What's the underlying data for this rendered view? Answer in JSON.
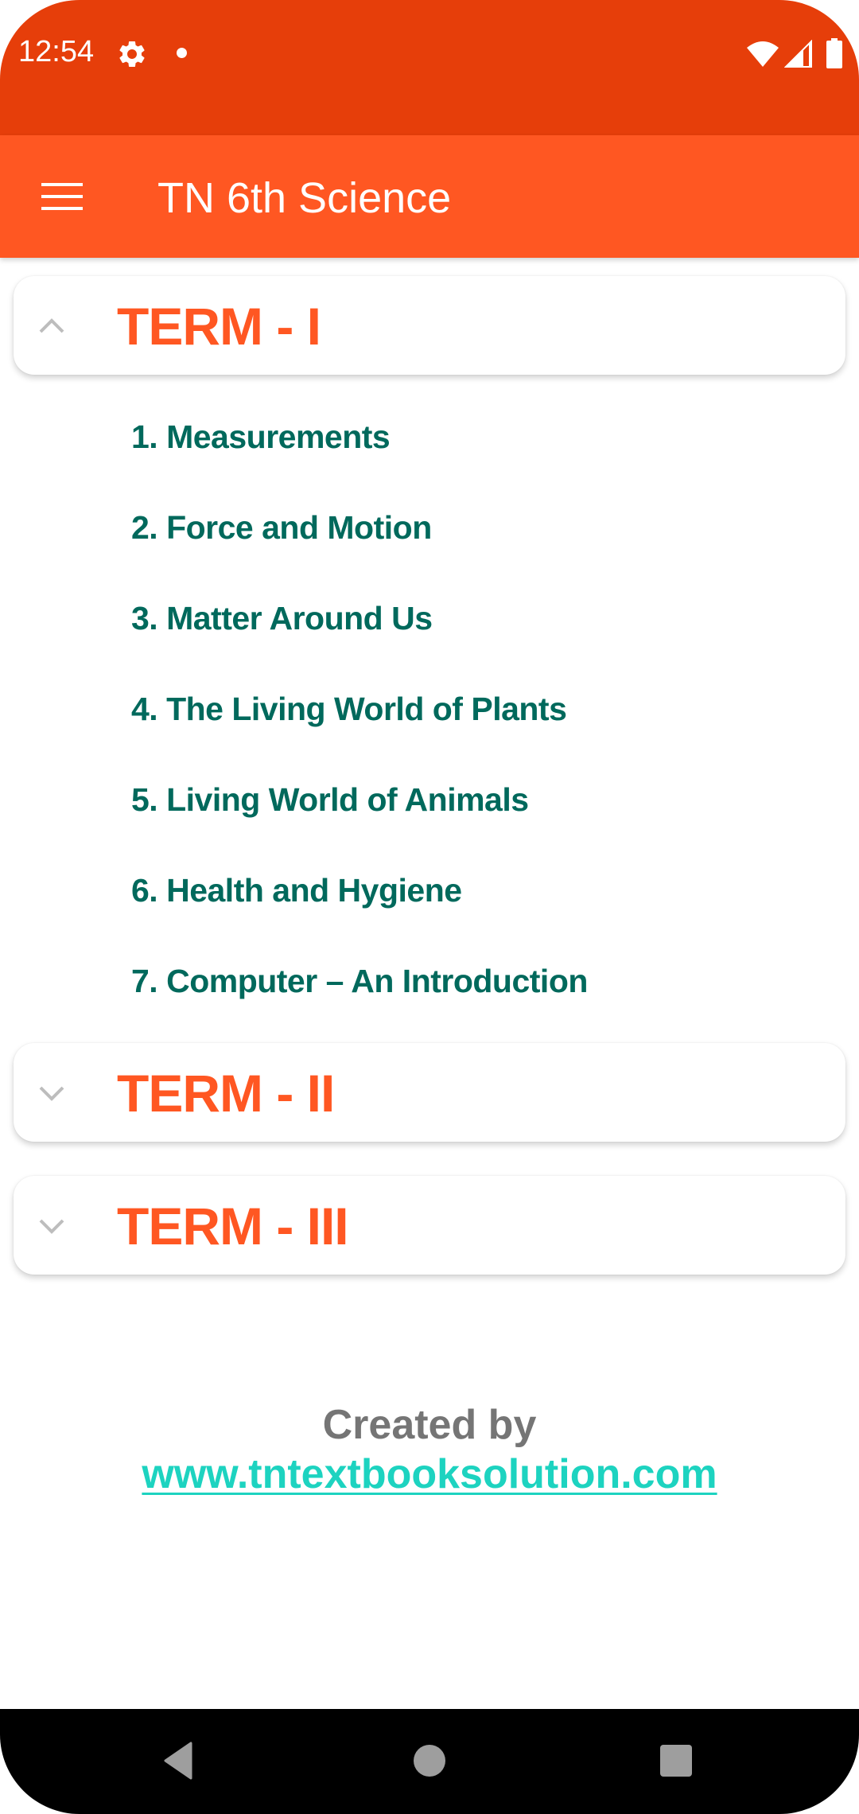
{
  "status_bar": {
    "time": "12:54",
    "icons": [
      "settings-gear-icon",
      "notification-dot-icon",
      "wifi-icon",
      "cell-signal-icon",
      "battery-icon"
    ]
  },
  "app_bar": {
    "title": "TN 6th Science",
    "menu_icon": "hamburger-menu-icon"
  },
  "terms": [
    {
      "title": "TERM - I",
      "expanded": true,
      "chevron": "chevron-up-icon",
      "chapters": [
        "1. Measurements",
        "2. Force and Motion",
        "3. Matter Around Us",
        "4. The Living World of Plants",
        "5. Living World of Animals",
        "6. Health and Hygiene",
        "7. Computer – An Introduction"
      ]
    },
    {
      "title": "TERM - II",
      "expanded": false,
      "chevron": "chevron-down-icon",
      "chapters": []
    },
    {
      "title": "TERM - III",
      "expanded": false,
      "chevron": "chevron-down-icon",
      "chapters": []
    }
  ],
  "credit": {
    "label": "Created by",
    "link_text": "www.tntextbooksolution.com"
  },
  "nav_bar": {
    "buttons": [
      "back",
      "home",
      "recents"
    ]
  },
  "colors": {
    "status_bar": "#E63E0A",
    "app_bar": "#FF5722",
    "term_title": "#FF5722",
    "chapter_text": "#00695C",
    "credit_label": "#757575",
    "credit_link": "#1DD3C0",
    "chevron": "#BDBDBD",
    "nav_icons": "#9E9E9E"
  }
}
